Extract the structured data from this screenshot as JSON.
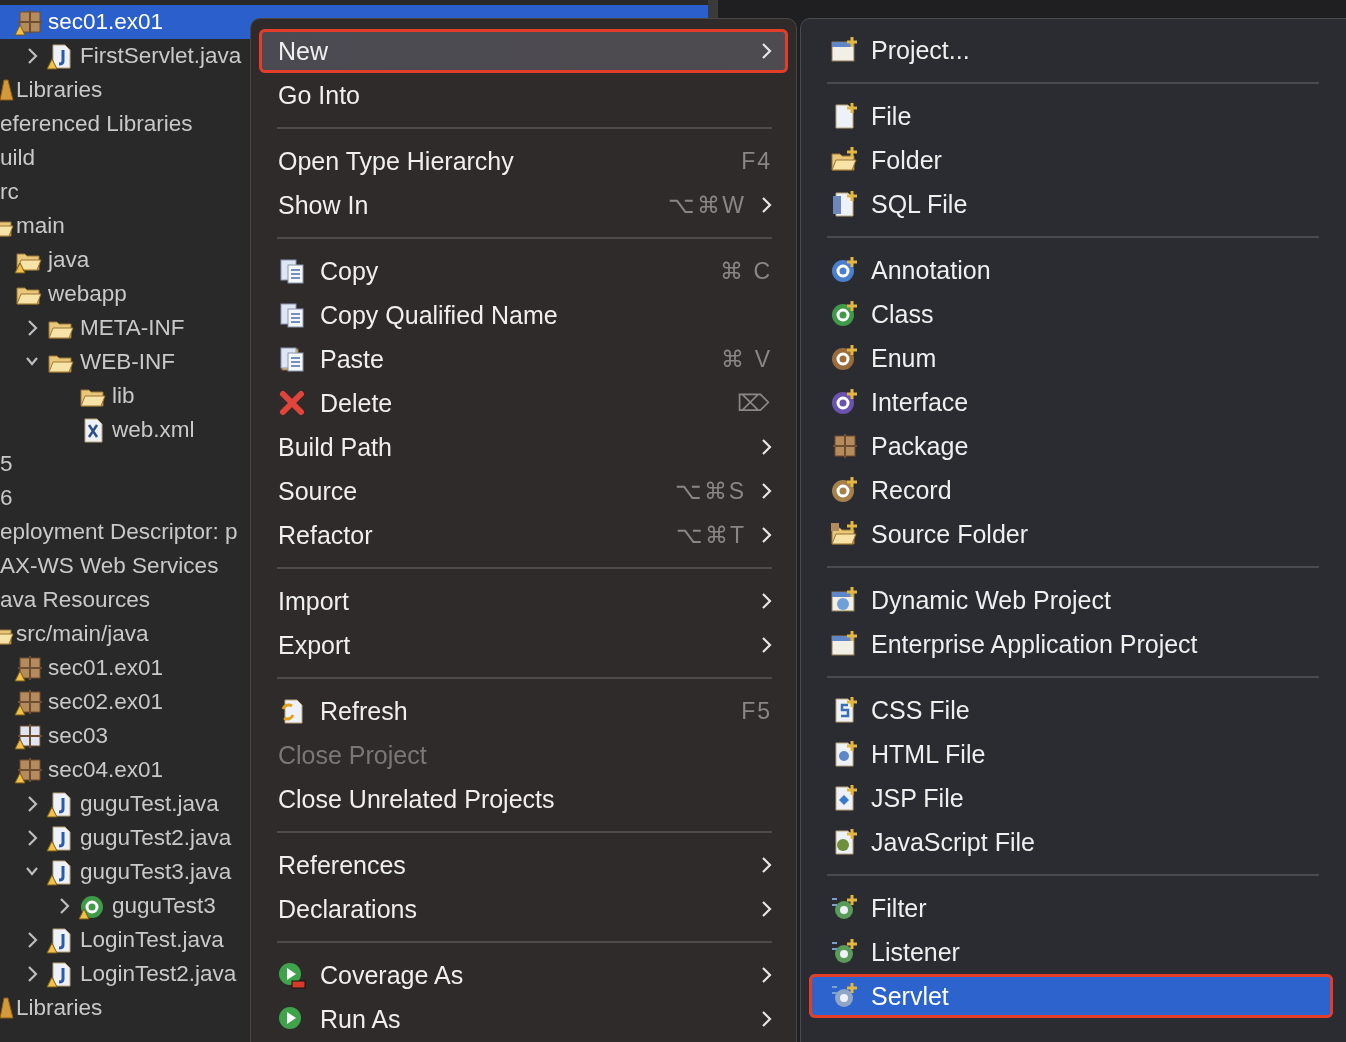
{
  "tree": {
    "continued_packages": [
      {
        "label": "sec01.ex01",
        "kind": "package",
        "warning": true,
        "selected": true,
        "children": [
          {
            "label": "FirstServlet.java",
            "kind": "java-file",
            "warning": true,
            "selected": false,
            "expanded": false
          }
        ]
      }
    ],
    "continued_entries": [
      {
        "label": "Libraries",
        "kind": "library",
        "selected": false
      }
    ],
    "items": [
      {
        "label": "eferenced Libraries",
        "selected": false
      },
      {
        "label": "uild",
        "selected": false
      },
      {
        "label": "rc",
        "selected": false,
        "children": [
          {
            "label": "main",
            "kind": "folder",
            "selected": false,
            "children": [
              {
                "label": "java",
                "kind": "folder",
                "warning": true,
                "selected": false
              },
              {
                "label": "webapp",
                "kind": "folder",
                "warning": false,
                "selected": false,
                "children": [
                  {
                    "label": "META-INF",
                    "kind": "folder",
                    "warning": false,
                    "selected": false,
                    "expanded": false
                  },
                  {
                    "label": "WEB-INF",
                    "kind": "folder",
                    "warning": false,
                    "selected": false,
                    "expanded": true,
                    "children": [
                      {
                        "label": "lib",
                        "kind": "folder",
                        "warning": false,
                        "selected": false
                      },
                      {
                        "label": "web.xml",
                        "kind": "xml-file",
                        "warning": false,
                        "selected": false
                      }
                    ]
                  }
                ]
              }
            ]
          }
        ]
      },
      {
        "label": "5",
        "selected": false
      },
      {
        "label": "6",
        "selected": false
      },
      {
        "label": "eployment Descriptor: p",
        "selected": false
      },
      {
        "label": "AX-WS Web Services",
        "selected": false
      },
      {
        "label": "ava Resources",
        "selected": false,
        "children": [
          {
            "label": "src/main/java",
            "kind": "source-folder",
            "selected": false,
            "children": [
              {
                "label": "sec01.ex01",
                "kind": "package",
                "warning": true,
                "selected": false
              },
              {
                "label": "sec02.ex01",
                "kind": "package",
                "warning": true,
                "selected": false
              },
              {
                "label": "sec03",
                "kind": "empty-package",
                "warning": true,
                "selected": false
              },
              {
                "label": "sec04.ex01",
                "kind": "package",
                "warning": true,
                "selected": false,
                "children": [
                  {
                    "label": "guguTest.java",
                    "kind": "java-file",
                    "warning": true,
                    "selected": false,
                    "expanded": false
                  },
                  {
                    "label": "guguTest2.java",
                    "kind": "java-file",
                    "warning": true,
                    "selected": false,
                    "expanded": false
                  },
                  {
                    "label": "guguTest3.java",
                    "kind": "java-file",
                    "warning": true,
                    "selected": false,
                    "expanded": true,
                    "children": [
                      {
                        "label": "guguTest3",
                        "kind": "class",
                        "warning": true,
                        "selected": false,
                        "expanded": false
                      }
                    ]
                  },
                  {
                    "label": "LoginTest.java",
                    "kind": "java-file",
                    "warning": true,
                    "selected": false,
                    "expanded": false
                  },
                  {
                    "label": "LoginTest2.java",
                    "kind": "java-file",
                    "warning": true,
                    "selected": false,
                    "expanded": false
                  }
                ]
              }
            ]
          },
          {
            "label": "Libraries",
            "kind": "library",
            "selected": false
          }
        ]
      }
    ]
  },
  "context_menu": {
    "groups": [
      [
        {
          "label": "New",
          "submenu": true,
          "selected": true,
          "disabled": false,
          "outlined": true
        },
        {
          "label": "Go Into",
          "submenu": false,
          "selected": false,
          "disabled": false,
          "outlined": false
        }
      ],
      [
        {
          "label": "Open Type Hierarchy",
          "shortcut": "F4",
          "submenu": false,
          "selected": false,
          "disabled": false,
          "outlined": false
        },
        {
          "label": "Show In",
          "shortcut": "⌥⌘W",
          "submenu": true,
          "selected": false,
          "disabled": false,
          "outlined": false
        }
      ],
      [
        {
          "label": "Copy",
          "kind": "copy",
          "shortcut": "⌘ C",
          "submenu": false,
          "selected": false,
          "disabled": false,
          "outlined": false
        },
        {
          "label": "Copy Qualified Name",
          "kind": "copy-name",
          "submenu": false,
          "selected": false,
          "disabled": false,
          "outlined": false
        },
        {
          "label": "Paste",
          "kind": "paste",
          "shortcut": "⌘ V",
          "submenu": false,
          "selected": false,
          "disabled": false,
          "outlined": false
        },
        {
          "label": "Delete",
          "kind": "delete",
          "shortcut": "⌦",
          "submenu": false,
          "selected": false,
          "disabled": false,
          "outlined": false
        },
        {
          "label": "Build Path",
          "submenu": true,
          "selected": false,
          "disabled": false,
          "outlined": false
        },
        {
          "label": "Source",
          "shortcut": "⌥⌘S",
          "submenu": true,
          "selected": false,
          "disabled": false,
          "outlined": false
        },
        {
          "label": "Refactor",
          "shortcut": "⌥⌘T",
          "submenu": true,
          "selected": false,
          "disabled": false,
          "outlined": false
        }
      ],
      [
        {
          "label": "Import",
          "submenu": true,
          "selected": false,
          "disabled": false,
          "outlined": false
        },
        {
          "label": "Export",
          "submenu": true,
          "selected": false,
          "disabled": false,
          "outlined": false
        }
      ],
      [
        {
          "label": "Refresh",
          "kind": "refresh",
          "shortcut": "F5",
          "submenu": false,
          "selected": false,
          "disabled": false,
          "outlined": false
        },
        {
          "label": "Close Project",
          "submenu": false,
          "selected": false,
          "disabled": true,
          "outlined": false
        },
        {
          "label": "Close Unrelated Projects",
          "submenu": false,
          "selected": false,
          "disabled": false,
          "outlined": false
        }
      ],
      [
        {
          "label": "References",
          "submenu": true,
          "selected": false,
          "disabled": false,
          "outlined": false
        },
        {
          "label": "Declarations",
          "submenu": true,
          "selected": false,
          "disabled": false,
          "outlined": false
        }
      ],
      [
        {
          "label": "Coverage As",
          "kind": "coverage",
          "submenu": true,
          "selected": false,
          "disabled": false,
          "outlined": false
        },
        {
          "label": "Run As",
          "kind": "run",
          "submenu": true,
          "selected": false,
          "disabled": false,
          "outlined": false
        }
      ]
    ]
  },
  "new_submenu": {
    "groups": [
      [
        {
          "label": "Project...",
          "kind": "project",
          "selected": false,
          "outlined": false
        }
      ],
      [
        {
          "label": "File",
          "kind": "file",
          "selected": false,
          "outlined": false
        },
        {
          "label": "Folder",
          "kind": "folder",
          "selected": false,
          "outlined": false
        },
        {
          "label": "SQL File",
          "kind": "sql",
          "selected": false,
          "outlined": false
        }
      ],
      [
        {
          "label": "Annotation",
          "kind": "annotation",
          "selected": false,
          "outlined": false
        },
        {
          "label": "Class",
          "kind": "class",
          "selected": false,
          "outlined": false
        },
        {
          "label": "Enum",
          "kind": "enum",
          "selected": false,
          "outlined": false
        },
        {
          "label": "Interface",
          "kind": "interface",
          "selected": false,
          "outlined": false
        },
        {
          "label": "Package",
          "kind": "package",
          "selected": false,
          "outlined": false
        },
        {
          "label": "Record",
          "kind": "record",
          "selected": false,
          "outlined": false
        },
        {
          "label": "Source Folder",
          "kind": "source-folder",
          "selected": false,
          "outlined": false
        }
      ],
      [
        {
          "label": "Dynamic Web Project",
          "kind": "web-project",
          "selected": false,
          "outlined": false
        },
        {
          "label": "Enterprise Application Project",
          "kind": "project",
          "selected": false,
          "outlined": false
        }
      ],
      [
        {
          "label": "CSS File",
          "kind": "css",
          "selected": false,
          "outlined": false
        },
        {
          "label": "HTML File",
          "kind": "html",
          "selected": false,
          "outlined": false
        },
        {
          "label": "JSP File",
          "kind": "jsp",
          "selected": false,
          "outlined": false
        },
        {
          "label": "JavaScript File",
          "kind": "js",
          "selected": false,
          "outlined": false
        }
      ],
      [
        {
          "label": "Filter",
          "kind": "filter",
          "selected": false,
          "outlined": false
        },
        {
          "label": "Listener",
          "kind": "listener",
          "selected": false,
          "outlined": false
        },
        {
          "label": "Servlet",
          "kind": "servlet",
          "selected": true,
          "outlined": true
        }
      ]
    ]
  }
}
